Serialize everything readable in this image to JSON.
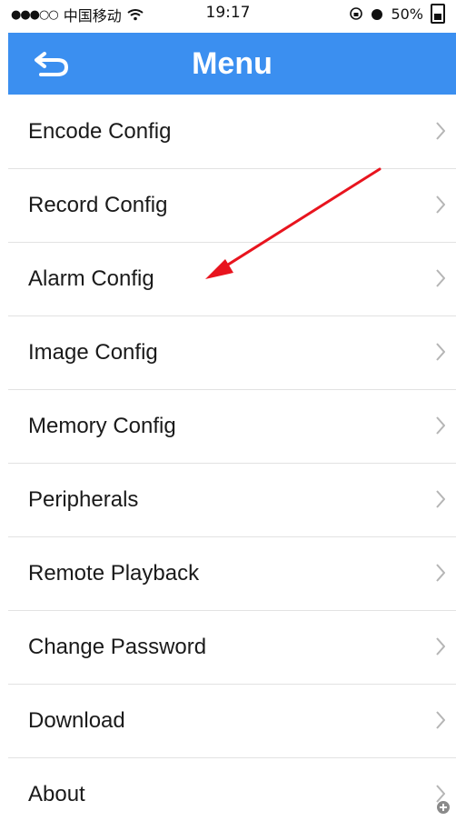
{
  "status_bar": {
    "signal_dots": "●●●○○",
    "carrier": "中国移动",
    "time": "19:17",
    "battery": "50%"
  },
  "header": {
    "title": "Menu"
  },
  "menu": {
    "items": [
      {
        "label": "Encode Config"
      },
      {
        "label": "Record Config"
      },
      {
        "label": "Alarm Config"
      },
      {
        "label": "Image Config"
      },
      {
        "label": "Memory Config"
      },
      {
        "label": "Peripherals"
      },
      {
        "label": "Remote Playback"
      },
      {
        "label": "Change Password"
      },
      {
        "label": "Download"
      },
      {
        "label": "About"
      }
    ]
  },
  "colors": {
    "header_bg": "#3b8ff0",
    "arrow": "#e8141e"
  }
}
